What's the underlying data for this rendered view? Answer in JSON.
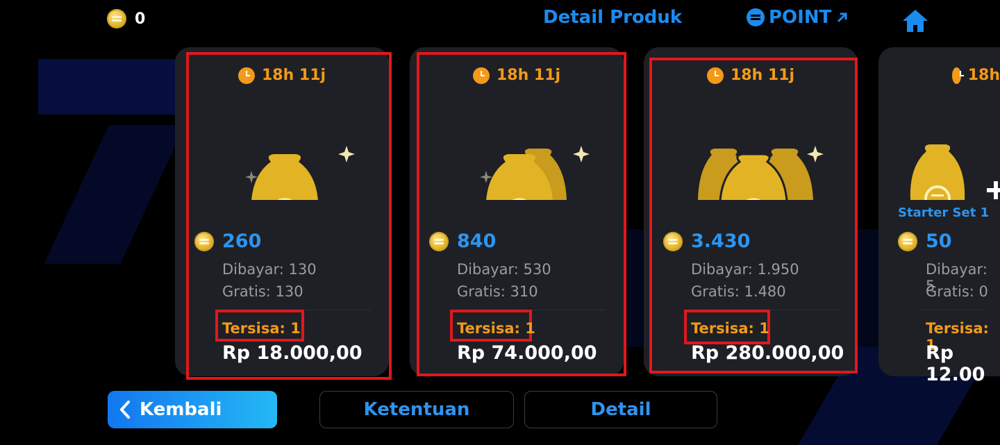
{
  "topbar": {
    "coin_balance": "0",
    "title": "Detail Produk",
    "point_label": "POINT",
    "home_icon": "home-icon"
  },
  "cards": [
    {
      "timer": "18h 11j",
      "amount": "260",
      "paid": "Dibayar: 130",
      "free": "Gratis: 130",
      "left": "Tersisa: 1",
      "price": "Rp 18.000,00",
      "bags": 1
    },
    {
      "timer": "18h 11j",
      "amount": "840",
      "paid": "Dibayar: 530",
      "free": "Gratis: 310",
      "left": "Tersisa: 1",
      "price": "Rp 74.000,00",
      "bags": 2
    },
    {
      "timer": "18h 11j",
      "amount": "3.430",
      "paid": "Dibayar: 1.950",
      "free": "Gratis: 1.480",
      "left": "Tersisa: 1",
      "price": "Rp 280.000,00",
      "bags": 3
    },
    {
      "timer": "18h",
      "set_label": "Starter Set 1",
      "amount": "50",
      "paid": "Dibayar: 5",
      "free": "Gratis: 0",
      "left": "Tersisa: 1",
      "price": "Rp 12.00",
      "bags": 1
    }
  ],
  "buttons": {
    "back": "Kembali",
    "terms": "Ketentuan",
    "detail": "Detail"
  },
  "colors": {
    "accent": "#1a8cf0",
    "highlight": "#e0181d",
    "warning": "#f39a1a"
  }
}
